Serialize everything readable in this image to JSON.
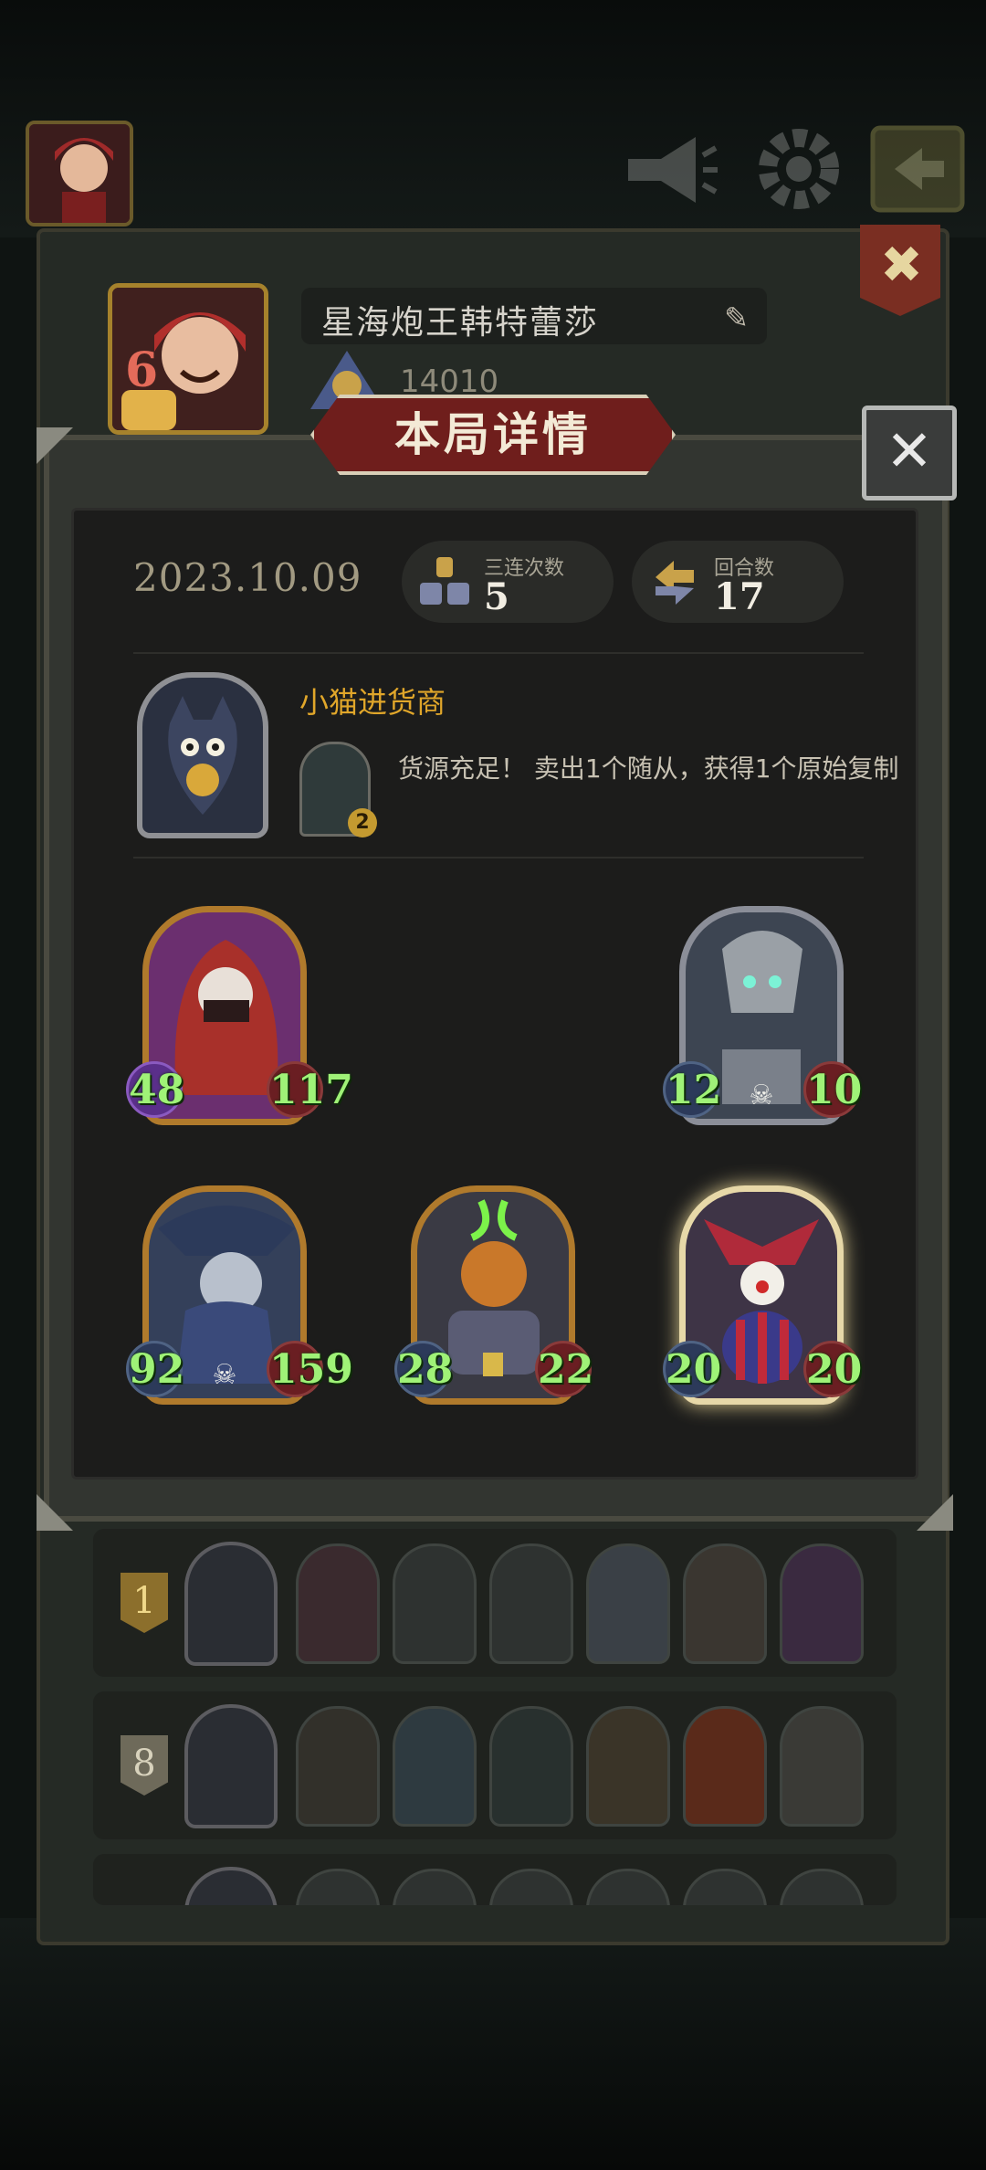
{
  "profile": {
    "name": "星海炮王韩特蕾莎",
    "score": "14010",
    "level": "6"
  },
  "panel": {
    "title": "本局详情",
    "date": "2023.10.09",
    "stats": [
      {
        "label": "三连次数",
        "value": "5",
        "icon": "triple-icon"
      },
      {
        "label": "回合数",
        "value": "17",
        "icon": "rounds-icon"
      }
    ],
    "hero": {
      "name": "小猫进货商",
      "skill_count": "2",
      "skill_desc": "货源充足！ 卖出1个随从，获得1个原始复制"
    },
    "cards": [
      {
        "atk": "48",
        "hp": "117",
        "frame": "gold-copper",
        "bg": "#6b2f6f"
      },
      {
        "atk": "12",
        "hp": "10",
        "frame": "silver",
        "bg": "#3d4552"
      },
      {
        "atk": "92",
        "hp": "159",
        "frame": "gold-copper",
        "bg": "#34405a"
      },
      {
        "atk": "28",
        "hp": "22",
        "frame": "gold-copper",
        "bg": "#3a3a44"
      },
      {
        "atk": "20",
        "hp": "20",
        "frame": "golden",
        "bg": "#3e3446"
      }
    ]
  },
  "history": [
    {
      "rank": "1"
    },
    {
      "rank": "8"
    }
  ],
  "colors": {
    "accent_gold": "#e0a62a",
    "stat_green": "#9ff277",
    "banner_red": "#6f1e1c"
  }
}
